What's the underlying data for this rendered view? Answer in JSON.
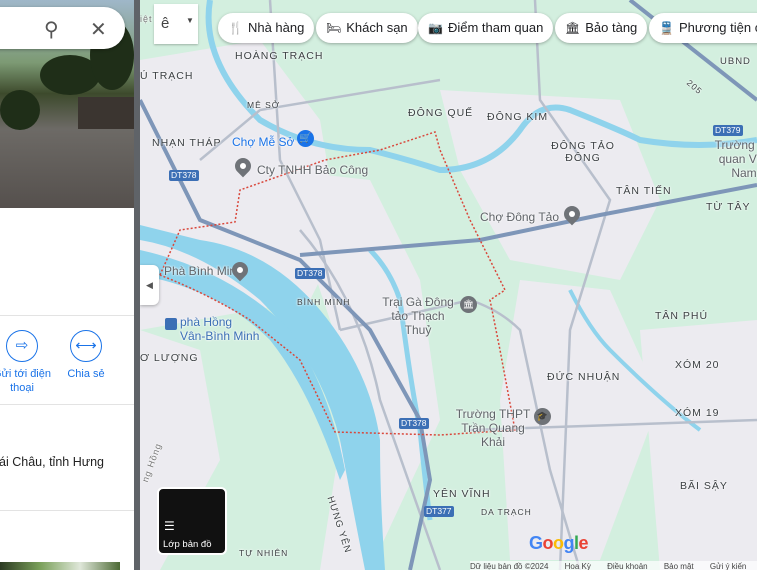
{
  "search": {
    "search_icon": "search-icon",
    "close_icon": "close-icon"
  },
  "panel": {
    "actions": [
      {
        "label": "Gửi tới điện thoại",
        "icon": "send-to-phone-icon"
      },
      {
        "label": "Chia sẻ",
        "icon": "share-icon"
      }
    ],
    "address": "Khoái Châu, tỉnh Hưng"
  },
  "map": {
    "language_button": "ê",
    "chips": [
      {
        "label": "Nhà hàng",
        "icon": "restaurant-icon",
        "glyph": "🍴"
      },
      {
        "label": "Khách sạn",
        "icon": "hotel-icon",
        "glyph": "🛏"
      },
      {
        "label": "Điểm tham quan",
        "icon": "camera-icon",
        "glyph": "📷"
      },
      {
        "label": "Bảo tàng",
        "icon": "museum-icon",
        "glyph": "🏛"
      },
      {
        "label": "Phương tiện công cộng",
        "icon": "transit-icon",
        "glyph": "🚆"
      }
    ],
    "places": [
      "HOÀNG TRẠCH",
      "Ú TRẠCH",
      "MÊ SỞ",
      "NHẠN THÁP",
      "ĐÔNG QUẾ",
      "ĐÔNG KIM",
      "ĐÔNG TẢO ĐÔNG",
      "TÂN TIẾN",
      "TỪ TÂY",
      "BÌNH MINH",
      "TÂN PHÚ",
      "XÓM 20",
      "XÓM 19",
      "ĐỨC NHUẬN",
      "BÃI SẬY",
      "YÊN VĨNH",
      "DA TRẠCH",
      "TỰ NHIÊN",
      "Ơ LƯỢNG",
      "UBND",
      "HƯNG YÊN",
      "iệt",
      "ng Hồng"
    ],
    "pois": [
      "Chợ Mễ Sở",
      "Cty TNHH Bảo Công",
      "Chợ Đông Tảo",
      "Phà Bình Minh",
      "phà Hồng Vân-Bình Minh",
      "Trại Gà Đông tảo Thạch Thuỷ",
      "Trường THPT Trần Quang Khải",
      "Trường Hả quan Việt Nam"
    ],
    "roads": [
      "DT378",
      "DT378",
      "DT378",
      "DT377",
      "DT379",
      "205"
    ],
    "layers_label": "Lớp bản đồ",
    "logo": "Google",
    "footer": [
      "Dữ liệu bản đồ ©2024",
      "Hoa Kỳ",
      "Điều khoản",
      "Bảo mật",
      "Gửi ý kiến"
    ]
  },
  "colors": {
    "land": "#d3efdf",
    "water": "#8fd3ec",
    "road": "#7e96b8",
    "boundary": "#d9473b",
    "accent": "#1a73e8"
  }
}
